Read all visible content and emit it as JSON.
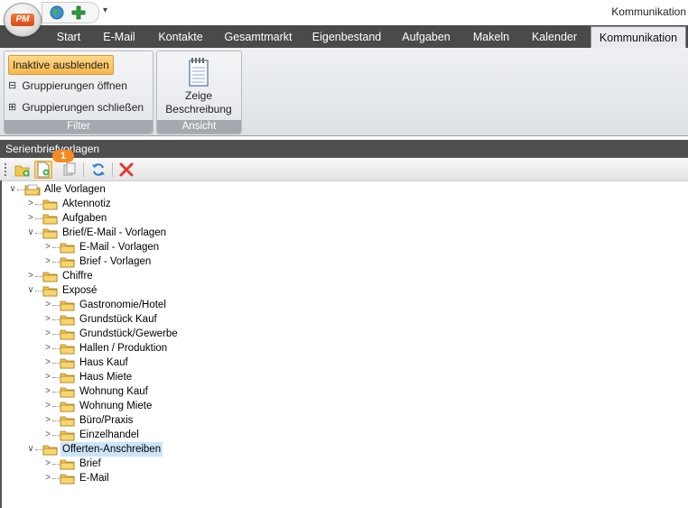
{
  "app": {
    "logo_text": "PM",
    "window_title": "Kommunikation",
    "qat_menu_glyph": "▾"
  },
  "ribbon": {
    "tabs": [
      {
        "label": "Start",
        "active": false
      },
      {
        "label": "E-Mail",
        "active": false
      },
      {
        "label": "Kontakte",
        "active": false
      },
      {
        "label": "Gesamtmarkt",
        "active": false
      },
      {
        "label": "Eigenbestand",
        "active": false
      },
      {
        "label": "Aufgaben",
        "active": false
      },
      {
        "label": "Makeln",
        "active": false
      },
      {
        "label": "Kalender",
        "active": false
      },
      {
        "label": "Kommunikation",
        "active": true
      }
    ],
    "groups": {
      "filter": {
        "caption": "Filter",
        "inaktive_label": "Inaktive ausblenden",
        "oeffnen_label": "Gruppierungen öffnen",
        "schliessen_label": "Gruppierungen schließen",
        "oeffnen_icon": "⊟",
        "schliessen_icon": "⊞"
      },
      "ansicht": {
        "caption": "Ansicht",
        "zeige_line1": "Zeige",
        "zeige_line2": "Beschreibung"
      }
    }
  },
  "panel": {
    "title": "Serienbriefvorlagen",
    "callout_number": "1",
    "toolbar_icons": [
      "new-folder-icon",
      "new-template-icon",
      "copy-icon",
      "refresh-icon",
      "delete-icon"
    ]
  },
  "tree": [
    {
      "label": "Alle Vorlagen",
      "level": 0,
      "toggle": "∨",
      "open": true,
      "root": true
    },
    {
      "label": "Aktennotiz",
      "level": 1,
      "toggle": ">"
    },
    {
      "label": "Aufgaben",
      "level": 1,
      "toggle": ">"
    },
    {
      "label": "Brief/E-Mail - Vorlagen",
      "level": 1,
      "toggle": "∨",
      "open": true
    },
    {
      "label": "E-Mail - Vorlagen",
      "level": 2,
      "toggle": ">"
    },
    {
      "label": "Brief - Vorlagen",
      "level": 2,
      "toggle": ">"
    },
    {
      "label": "Chiffre",
      "level": 1,
      "toggle": ">"
    },
    {
      "label": "Exposé",
      "level": 1,
      "toggle": "∨",
      "open": true
    },
    {
      "label": "Gastronomie/Hotel",
      "level": 2,
      "toggle": ">"
    },
    {
      "label": "Grundstück Kauf",
      "level": 2,
      "toggle": ">"
    },
    {
      "label": "Grundstück/Gewerbe",
      "level": 2,
      "toggle": ">"
    },
    {
      "label": "Hallen / Produktion",
      "level": 2,
      "toggle": ">"
    },
    {
      "label": "Haus Kauf",
      "level": 2,
      "toggle": ">"
    },
    {
      "label": "Haus Miete",
      "level": 2,
      "toggle": ">"
    },
    {
      "label": "Wohnung Kauf",
      "level": 2,
      "toggle": ">"
    },
    {
      "label": "Wohnung Miete",
      "level": 2,
      "toggle": ">"
    },
    {
      "label": "Büro/Praxis",
      "level": 2,
      "toggle": ">"
    },
    {
      "label": "Einzelhandel",
      "level": 2,
      "toggle": ">"
    },
    {
      "label": "Offerten-Anschreiben",
      "level": 1,
      "toggle": "∨",
      "open": true,
      "selected": true
    },
    {
      "label": "Brief",
      "level": 2,
      "toggle": ">"
    },
    {
      "label": "E-Mail",
      "level": 2,
      "toggle": ">"
    }
  ],
  "colors": {
    "tab_bar": "#4a4a4a",
    "active_button": "#f6b64c",
    "folder": "#f2c94c",
    "selection": "#cce4f7",
    "callout": "#f58a1f"
  }
}
